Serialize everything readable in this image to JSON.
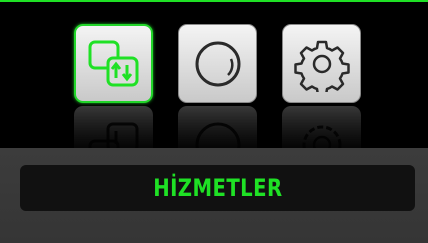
{
  "colors": {
    "accent": "#1fe125",
    "icon_stroke": "#2a2a2a",
    "panel": "#393939",
    "label_bg": "#111111"
  },
  "icons": [
    {
      "name": "transfer-icon",
      "selected": true
    },
    {
      "name": "circle-icon",
      "selected": false
    },
    {
      "name": "gear-icon",
      "selected": false
    }
  ],
  "label": {
    "text": "HİZMETLER"
  }
}
